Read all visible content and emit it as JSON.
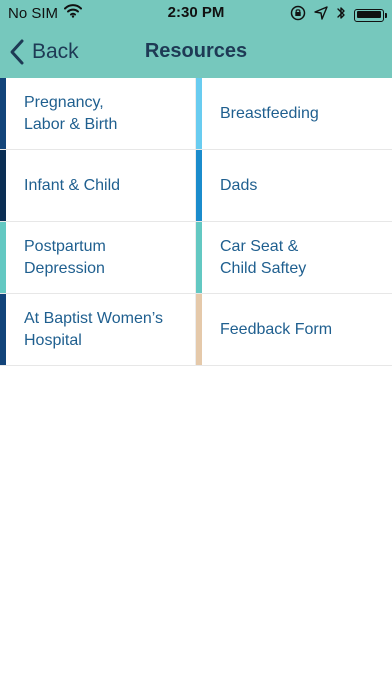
{
  "status_bar": {
    "carrier": "No SIM",
    "time": "2:30 PM"
  },
  "nav": {
    "back_label": "Back",
    "title": "Resources"
  },
  "colors": {
    "header_bg": "#76c8bd",
    "accent_dark_blue": "#12447a",
    "accent_navy": "#0a2e54",
    "accent_teal": "#63c8c2",
    "accent_light_blue": "#69ccf0",
    "accent_medium_blue": "#1b8ccc",
    "accent_tan": "#e5c9aa",
    "text_link_blue": "#1f5f8f"
  },
  "resources": {
    "items": [
      {
        "label": "Pregnancy,\nLabor & Birth",
        "color": "#12447a"
      },
      {
        "label": "Breastfeeding",
        "color": "#69ccf0"
      },
      {
        "label": "Infant & Child",
        "color": "#0a2e54"
      },
      {
        "label": "Dads",
        "color": "#1b8ccc"
      },
      {
        "label": "Postpartum\nDepression",
        "color": "#63c8c2"
      },
      {
        "label": "Car Seat &\nChild Saftey",
        "color": "#63c8c2"
      },
      {
        "label": "At Baptist Women’s\nHospital",
        "color": "#12447a"
      },
      {
        "label": "Feedback Form",
        "color": "#e5c9aa"
      }
    ]
  }
}
